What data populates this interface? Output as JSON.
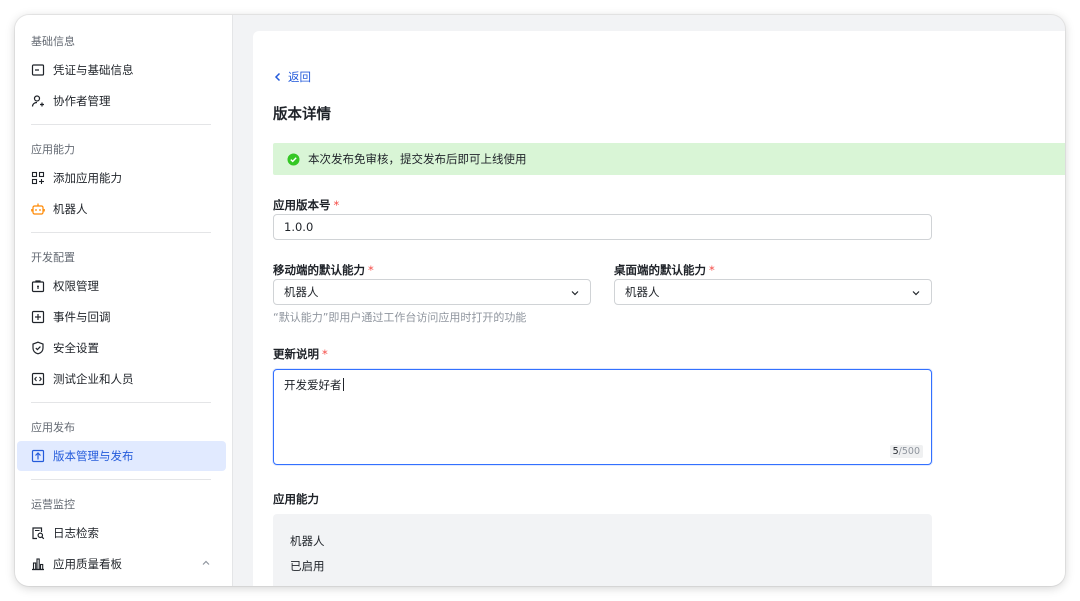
{
  "sidebar": {
    "groups": [
      {
        "title": "基础信息",
        "items": [
          {
            "label": "凭证与基础信息",
            "icon": "credential-icon"
          },
          {
            "label": "协作者管理",
            "icon": "add-user-icon"
          }
        ]
      },
      {
        "title": "应用能力",
        "items": [
          {
            "label": "添加应用能力",
            "icon": "add-capability-icon"
          },
          {
            "label": "机器人",
            "icon": "robot-icon"
          }
        ]
      },
      {
        "title": "开发配置",
        "items": [
          {
            "label": "权限管理",
            "icon": "permission-icon"
          },
          {
            "label": "事件与回调",
            "icon": "event-icon"
          },
          {
            "label": "安全设置",
            "icon": "shield-icon"
          },
          {
            "label": "测试企业和人员",
            "icon": "test-code-icon"
          }
        ]
      },
      {
        "title": "应用发布",
        "items": [
          {
            "label": "版本管理与发布",
            "icon": "upload-icon",
            "active": true
          }
        ]
      },
      {
        "title": "运营监控",
        "items": [
          {
            "label": "日志检索",
            "icon": "log-search-icon"
          },
          {
            "label": "应用质量看板",
            "icon": "chart-icon",
            "expandable": true
          }
        ]
      }
    ]
  },
  "main": {
    "back_label": "返回",
    "title": "版本详情",
    "banner": "本次发布免审核，提交发布后即可上线使用",
    "version": {
      "label": "应用版本号",
      "required_mark": "*",
      "value": "1.0.0"
    },
    "mobile_default": {
      "label": "移动端的默认能力",
      "required_mark": "*",
      "value": "机器人"
    },
    "desktop_default": {
      "label": "桌面端的默认能力",
      "required_mark": "*",
      "value": "机器人"
    },
    "default_hint": "“默认能力”即用户通过工作台访问应用时打开的功能",
    "update_notes": {
      "label": "更新说明",
      "required_mark": "*",
      "value": "开发爱好者",
      "count": "5",
      "max": "/500"
    },
    "capabilities": {
      "title": "应用能力",
      "name": "机器人",
      "status": "已启用"
    }
  },
  "colors": {
    "accent": "#245bdb",
    "active_bg": "#e1eaff",
    "success_bg": "#d9f5d6",
    "success_icon": "#34c724",
    "required": "#f54a45"
  }
}
